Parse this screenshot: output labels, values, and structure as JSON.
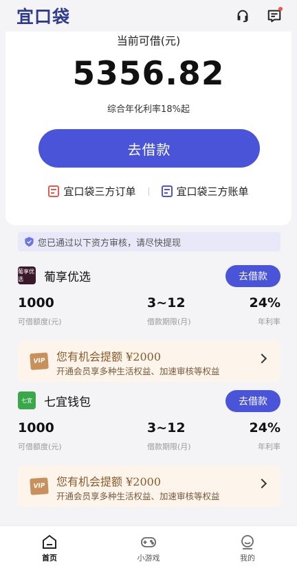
{
  "header": {
    "logo": "宜口袋",
    "icons": [
      "headset-icon",
      "message-icon"
    ]
  },
  "loan": {
    "amount_label": "当前可借(元)",
    "amount": "5356.82",
    "rate_note": "综合年化利率18%起",
    "borrow_label": "去借款",
    "link_orders": "宜口袋三方订单",
    "link_bills": "宜口袋三方账单"
  },
  "notice": "您已通过以下资方审核，请尽快提现",
  "products": [
    {
      "name": "葡享优选",
      "logo_text": "葡享优选",
      "logo_color": "#3a1a2a",
      "button": "去借款",
      "stats": [
        {
          "value": "1000",
          "label": "可借额度(元)"
        },
        {
          "value": "3~12",
          "label": "借款期限(月)"
        },
        {
          "value": "24%",
          "label": "年利率"
        }
      ],
      "promo": {
        "title": "您有机会提额",
        "amount": "¥2000",
        "sub": "开通会员享多种生活权益、加速审核等权益",
        "badge": "VIP"
      }
    },
    {
      "name": "七宜钱包",
      "logo_text": "七宜",
      "logo_color": "#3aa84a",
      "button": "去借款",
      "stats": [
        {
          "value": "1000",
          "label": "可借额度(元)"
        },
        {
          "value": "3~12",
          "label": "借款期限(月)"
        },
        {
          "value": "24%",
          "label": "年利率"
        }
      ],
      "promo": {
        "title": "您有机会提额",
        "amount": "¥2000",
        "sub": "开通会员享多种生活权益、加速审核等权益",
        "badge": "VIP"
      }
    }
  ],
  "tabbar": [
    {
      "label": "首页",
      "icon": "home-icon",
      "active": true
    },
    {
      "label": "小游戏",
      "icon": "gamepad-icon",
      "active": false
    },
    {
      "label": "我的",
      "icon": "profile-icon",
      "active": false
    }
  ],
  "colors": {
    "accent": "#4a54d8",
    "promo_bg": "#fdf5ec",
    "notice_bg": "#e7e8f8"
  }
}
